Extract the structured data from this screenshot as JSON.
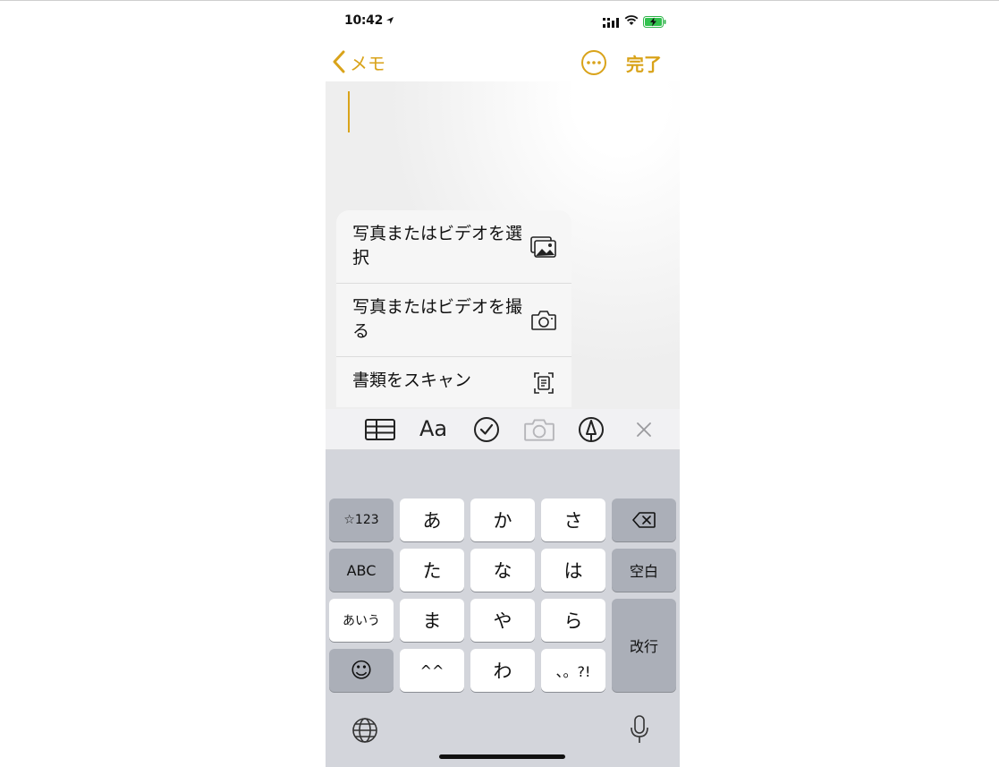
{
  "status_bar": {
    "time": "10:42"
  },
  "nav": {
    "back_label": "メモ",
    "done_label": "完了"
  },
  "menu": {
    "items": [
      {
        "label": "写真またはビデオを選択",
        "icon": "photo-library-icon"
      },
      {
        "label": "写真またはビデオを撮る",
        "icon": "camera-icon"
      },
      {
        "label": "書類をスキャン",
        "icon": "document-scan-icon"
      }
    ]
  },
  "toolbar": {
    "format_label": "Aa",
    "items": [
      "table-icon",
      "format-text",
      "checklist-icon",
      "camera-icon",
      "markup-pen-icon",
      "close-icon"
    ]
  },
  "keyboard": {
    "row1": [
      "☆123",
      "あ",
      "か",
      "さ"
    ],
    "row2": [
      "ABC",
      "た",
      "な",
      "は",
      "空白"
    ],
    "row3": [
      "あいう",
      "ま",
      "や",
      "ら",
      "改行"
    ],
    "row4": [
      "^^",
      "わ",
      "、。?!"
    ],
    "emoji_label": "☺"
  },
  "colors": {
    "accent": "#d9a31a",
    "keyboard_bg": "#d3d5db",
    "dark_key": "#abafb8"
  }
}
